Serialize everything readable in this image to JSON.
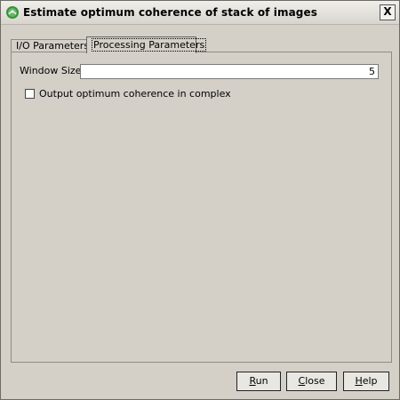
{
  "window": {
    "title": "Estimate optimum coherence of stack of images",
    "close_glyph": "X"
  },
  "tabs": [
    {
      "label": "I/O Parameters",
      "selected": false
    },
    {
      "label": "Processing Parameters",
      "selected": true
    }
  ],
  "form": {
    "window_size_label": "Window Size:",
    "window_size_value": "5",
    "checkbox_label": "Output optimum coherence in complex",
    "checkbox_checked": false
  },
  "buttons": {
    "run": {
      "mnemonic": "R",
      "rest": "un"
    },
    "close": {
      "mnemonic": "C",
      "rest": "lose"
    },
    "help": {
      "mnemonic": "H",
      "rest": "elp"
    }
  },
  "icons": {
    "app_icon": "snap-app-icon",
    "close_icon": "close-icon"
  }
}
